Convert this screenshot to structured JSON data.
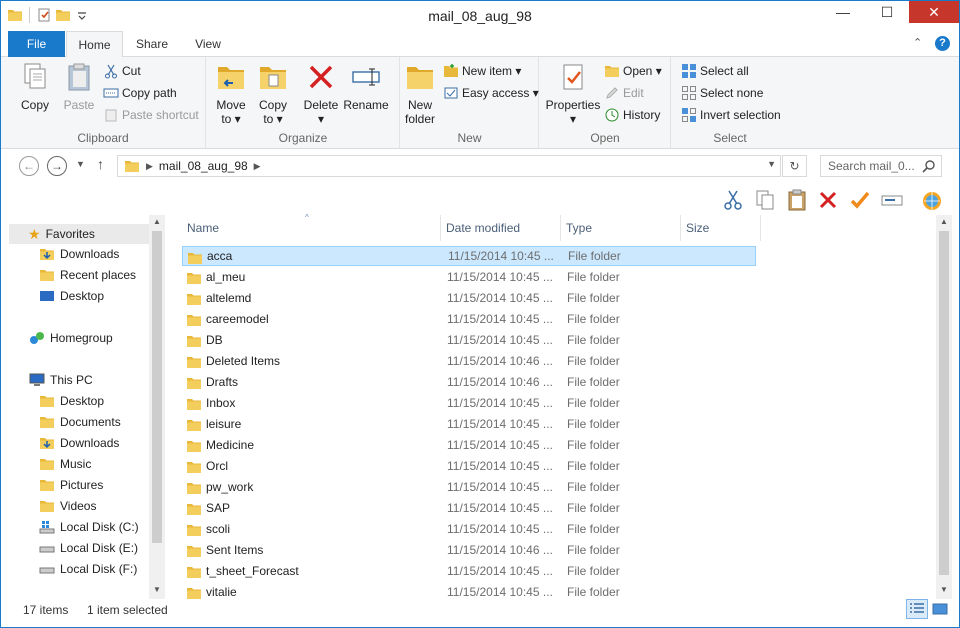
{
  "window": {
    "title": "mail_08_aug_98",
    "min": "—",
    "max": "☐",
    "close": "✕"
  },
  "tabs": {
    "file": "File",
    "home": "Home",
    "share": "Share",
    "view": "View"
  },
  "ribbon": {
    "clipboard": {
      "label": "Clipboard",
      "copy": "Copy",
      "paste": "Paste",
      "cut": "Cut",
      "copy_path": "Copy path",
      "paste_shortcut": "Paste shortcut"
    },
    "organize": {
      "label": "Organize",
      "move_to": "Move",
      "move_to2": "to ▾",
      "copy_to": "Copy",
      "copy_to2": "to ▾",
      "delete": "Delete",
      "delete2": "▾",
      "rename": "Rename"
    },
    "new": {
      "label": "New",
      "new_folder": "New",
      "new_folder2": "folder",
      "new_item": "New item ▾",
      "easy_access": "Easy access ▾"
    },
    "open": {
      "label": "Open",
      "properties": "Properties",
      "properties2": "▾",
      "open": "Open ▾",
      "edit": "Edit",
      "history": "History"
    },
    "select": {
      "label": "Select",
      "select_all": "Select all",
      "select_none": "Select none",
      "invert": "Invert selection"
    }
  },
  "address": {
    "path": "mail_08_aug_98",
    "search_placeholder": "Search mail_0..."
  },
  "nav": {
    "favorites": "Favorites",
    "fav_items": [
      "Downloads",
      "Recent places",
      "Desktop"
    ],
    "homegroup": "Homegroup",
    "thispc": "This PC",
    "pc_items": [
      "Desktop",
      "Documents",
      "Downloads",
      "Music",
      "Pictures",
      "Videos",
      "Local Disk (C:)",
      "Local Disk (E:)",
      "Local Disk (F:)"
    ]
  },
  "columns": {
    "name": "Name",
    "date": "Date modified",
    "type": "Type",
    "size": "Size"
  },
  "files": [
    {
      "name": "acca",
      "date": "11/15/2014 10:45 ...",
      "type": "File folder"
    },
    {
      "name": "al_meu",
      "date": "11/15/2014 10:45 ...",
      "type": "File folder"
    },
    {
      "name": "altelemd",
      "date": "11/15/2014 10:45 ...",
      "type": "File folder"
    },
    {
      "name": "careemodel",
      "date": "11/15/2014 10:45 ...",
      "type": "File folder"
    },
    {
      "name": "DB",
      "date": "11/15/2014 10:45 ...",
      "type": "File folder"
    },
    {
      "name": "Deleted Items",
      "date": "11/15/2014 10:46 ...",
      "type": "File folder"
    },
    {
      "name": "Drafts",
      "date": "11/15/2014 10:46 ...",
      "type": "File folder"
    },
    {
      "name": "Inbox",
      "date": "11/15/2014 10:45 ...",
      "type": "File folder"
    },
    {
      "name": "leisure",
      "date": "11/15/2014 10:45 ...",
      "type": "File folder"
    },
    {
      "name": "Medicine",
      "date": "11/15/2014 10:45 ...",
      "type": "File folder"
    },
    {
      "name": "Orcl",
      "date": "11/15/2014 10:45 ...",
      "type": "File folder"
    },
    {
      "name": "pw_work",
      "date": "11/15/2014 10:45 ...",
      "type": "File folder"
    },
    {
      "name": "SAP",
      "date": "11/15/2014 10:45 ...",
      "type": "File folder"
    },
    {
      "name": "scoli",
      "date": "11/15/2014 10:45 ...",
      "type": "File folder"
    },
    {
      "name": "Sent Items",
      "date": "11/15/2014 10:46 ...",
      "type": "File folder"
    },
    {
      "name": "t_sheet_Forecast",
      "date": "11/15/2014 10:45 ...",
      "type": "File folder"
    },
    {
      "name": "vitalie",
      "date": "11/15/2014 10:45 ...",
      "type": "File folder"
    }
  ],
  "status": {
    "count": "17 items",
    "selected": "1 item selected"
  },
  "colors": {
    "accent": "#1979ca",
    "selection": "#cce8ff",
    "close": "#c7362b",
    "folder": "#e8b83a"
  }
}
